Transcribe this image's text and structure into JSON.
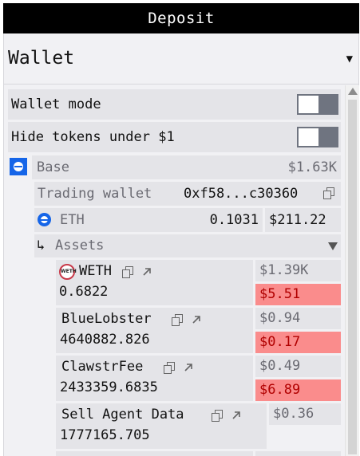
{
  "title": "Deposit",
  "wallet": {
    "label": "Wallet",
    "caret": "▼"
  },
  "settings": {
    "wallet_mode": {
      "label": "Wallet mode",
      "on": false
    },
    "hide_small": {
      "label": "Hide tokens under $1",
      "on": false
    }
  },
  "chain": {
    "name": "Base",
    "total": "$1.63K",
    "icon": "base-chain-icon",
    "trading_wallet_label": "Trading wallet",
    "trading_wallet_address": "0xf58...c30360",
    "native": {
      "symbol": "ETH",
      "amount": "0.1031",
      "value": "$211.22"
    },
    "assets_label": "Assets",
    "assets_arrow": "↳"
  },
  "tokens": [
    {
      "name": "WETH",
      "amount": "0.6822",
      "value": "$1.39K",
      "pnl": "$5.51",
      "icon_text": "WETH"
    },
    {
      "name": "BlueLobster",
      "amount": "4640882.826",
      "value": "$0.94",
      "pnl": "$0.17"
    },
    {
      "name": "ClawstrFee",
      "amount": "2433359.6835",
      "value": "$0.49",
      "pnl": "$6.89"
    },
    {
      "name": "Sell Agent Data",
      "amount": "1777165.705",
      "value": "$0.36",
      "pnl": ""
    }
  ],
  "colors": {
    "accent": "#1565e8",
    "loss_bg": "#fa8c8c",
    "loss_text": "#b10000",
    "header_bg": "#000000"
  }
}
